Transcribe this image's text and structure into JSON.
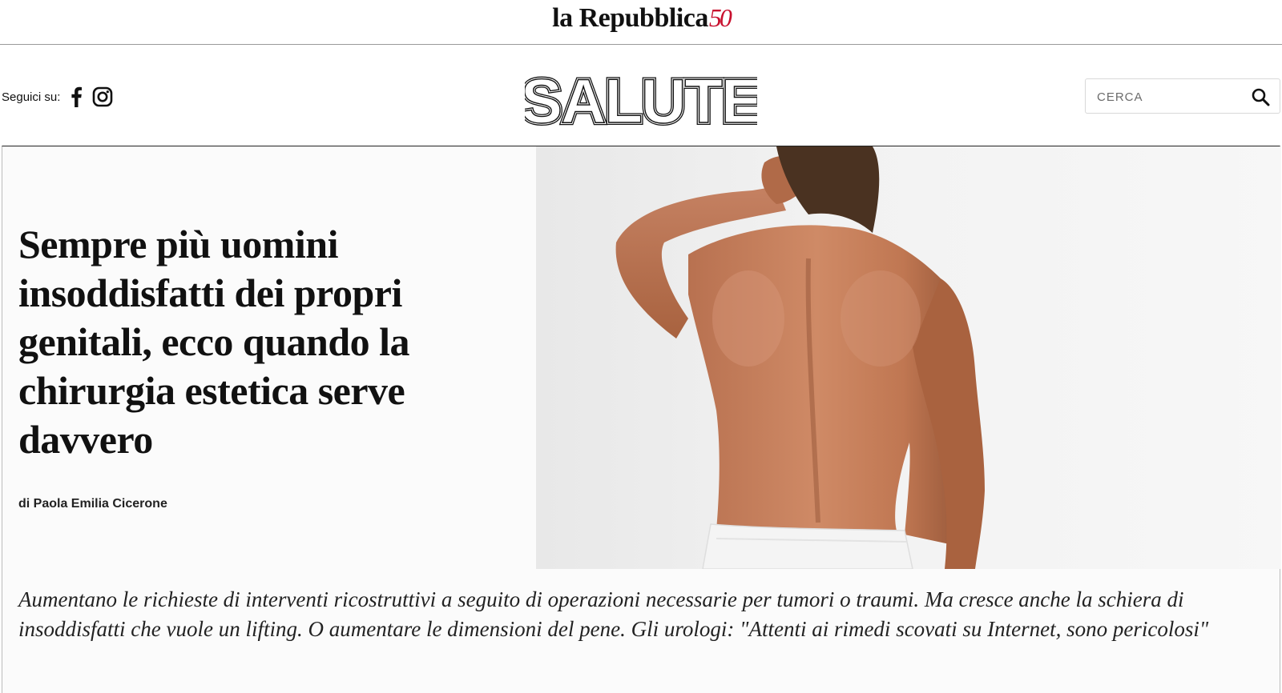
{
  "topbar": {
    "brand_name": "la Repubblica",
    "brand_anniversary": "50"
  },
  "header": {
    "follow_label": "Seguici su:",
    "social": [
      {
        "icon": "facebook-icon"
      },
      {
        "icon": "instagram-icon"
      }
    ],
    "section_title": "SALUTE",
    "search": {
      "placeholder": "CERCA",
      "icon": "search-icon"
    }
  },
  "article": {
    "headline": "Sempre più uomini insoddisfatti dei propri genitali, ecco quando la chirurgia estetica serve davvero",
    "byline": "di Paola Emilia Cicerone",
    "summary": "Aumentano le richieste di interventi ricostruttivi a seguito di operazioni necessarie per tumori o traumi. Ma cresce anche la schiera di insoddisfatti che vuole un lifting. O aumentare le dimensioni del pene. Gli urologi: \"Attenti ai rimedi scovati su Internet, sono pericolosi\""
  },
  "colors": {
    "brand_accent": "#c8102e",
    "text": "#111111",
    "divider": "#9a9a9a"
  }
}
